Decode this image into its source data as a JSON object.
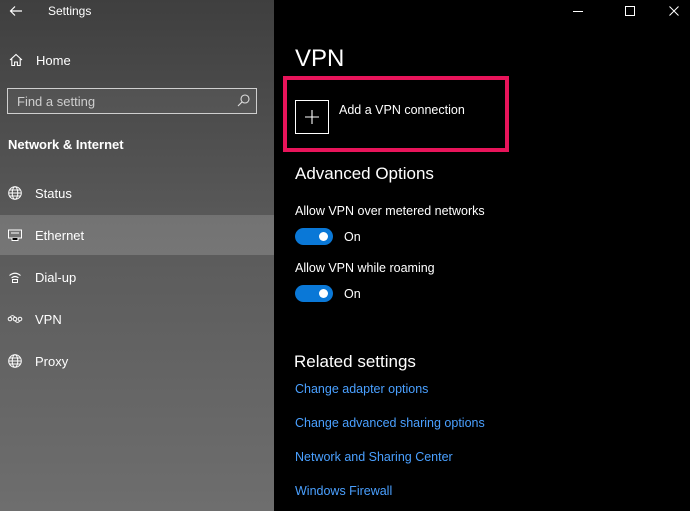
{
  "app": {
    "title": "Settings"
  },
  "sidebar": {
    "home_label": "Home",
    "search": {
      "placeholder": "Find a setting",
      "value": ""
    },
    "section_title": "Network & Internet",
    "items": [
      {
        "label": "Status",
        "icon": "globe-icon",
        "active": false
      },
      {
        "label": "Ethernet",
        "icon": "ethernet-icon",
        "active": true
      },
      {
        "label": "Dial-up",
        "icon": "dialup-icon",
        "active": false
      },
      {
        "label": "VPN",
        "icon": "vpn-icon",
        "active": false
      },
      {
        "label": "Proxy",
        "icon": "globe-icon",
        "active": false
      }
    ]
  },
  "main": {
    "title": "VPN",
    "add_vpn_label": "Add a VPN connection",
    "advanced": {
      "heading": "Advanced Options",
      "settings": [
        {
          "label": "Allow VPN over metered networks",
          "state": "On",
          "enabled": true
        },
        {
          "label": "Allow VPN while roaming",
          "state": "On",
          "enabled": true
        }
      ]
    },
    "related": {
      "heading": "Related settings",
      "links": [
        "Change adapter options",
        "Change advanced sharing options",
        "Network and Sharing Center",
        "Windows Firewall"
      ]
    }
  },
  "colors": {
    "accent": "#0a78d7",
    "link": "#4aa0ff",
    "highlight": "#e8145a"
  }
}
